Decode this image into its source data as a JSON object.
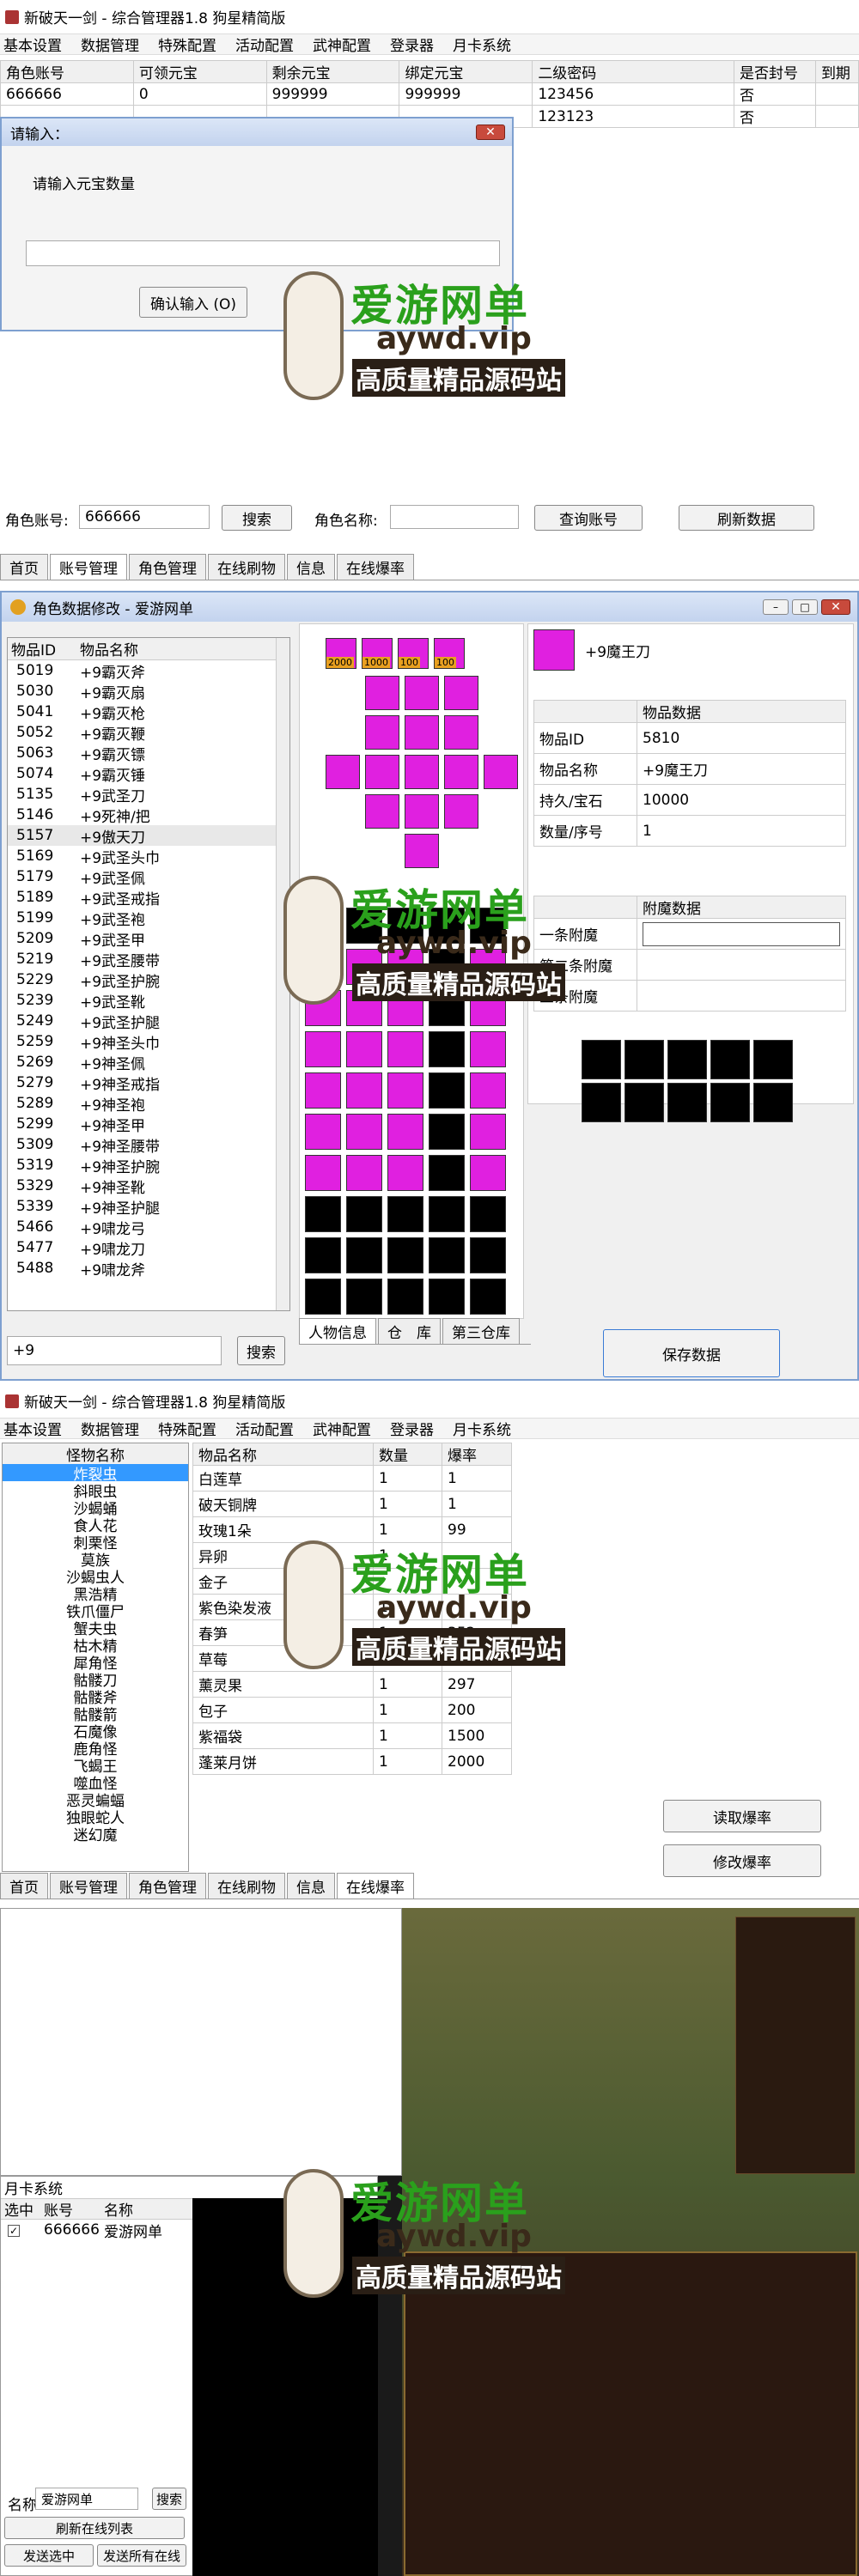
{
  "s1": {
    "title": "新破天一剑 - 综合管理器1.8 狗星精简版",
    "menu": [
      "基本设置",
      "数据管理",
      "特殊配置",
      "活动配置",
      "武神配置",
      "登录器",
      "月卡系统"
    ],
    "headers": [
      "角色账号",
      "可领元宝",
      "剩余元宝",
      "绑定元宝",
      "二级密码",
      "是否封号",
      "到期"
    ],
    "rows": [
      [
        "666666",
        "0",
        "999999",
        "999999",
        "123456",
        "否",
        ""
      ],
      [
        "",
        "",
        "",
        "",
        "123123",
        "否",
        ""
      ]
    ],
    "dialog": {
      "title": "请输入：",
      "prompt": "请输入元宝数量",
      "ok": "确认输入 (O)"
    },
    "search": {
      "acct_label": "角色账号:",
      "acct_value": "666666",
      "search_btn": "搜索",
      "name_label": "角色名称:",
      "query_btn": "查询账号",
      "refresh_btn": "刷新数据"
    },
    "tabs": [
      "首页",
      "账号管理",
      "角色管理",
      "在线刷物",
      "信息",
      "在线爆率"
    ]
  },
  "s2": {
    "title": "角色数据修改 - 爱游网单",
    "col_id": "物品ID",
    "col_name": "物品名称",
    "items": [
      [
        "5019",
        "+9霸灭斧"
      ],
      [
        "5030",
        "+9霸灭扇"
      ],
      [
        "5041",
        "+9霸灭枪"
      ],
      [
        "5052",
        "+9霸灭鞭"
      ],
      [
        "5063",
        "+9霸灭镖"
      ],
      [
        "5074",
        "+9霸灭锤"
      ],
      [
        "5135",
        "+9武圣刀"
      ],
      [
        "5146",
        "+9死神/把"
      ],
      [
        "5157",
        "+9傲天刀"
      ],
      [
        "5169",
        "+9武圣头巾"
      ],
      [
        "5179",
        "+9武圣佩"
      ],
      [
        "5189",
        "+9武圣戒指"
      ],
      [
        "5199",
        "+9武圣袍"
      ],
      [
        "5209",
        "+9武圣甲"
      ],
      [
        "5219",
        "+9武圣腰带"
      ],
      [
        "5229",
        "+9武圣护腕"
      ],
      [
        "5239",
        "+9武圣靴"
      ],
      [
        "5249",
        "+9武圣护腿"
      ],
      [
        "5259",
        "+9神圣头巾"
      ],
      [
        "5269",
        "+9神圣佩"
      ],
      [
        "5279",
        "+9神圣戒指"
      ],
      [
        "5289",
        "+9神圣袍"
      ],
      [
        "5299",
        "+9神圣甲"
      ],
      [
        "5309",
        "+9神圣腰带"
      ],
      [
        "5319",
        "+9神圣护腕"
      ],
      [
        "5329",
        "+9神圣靴"
      ],
      [
        "5339",
        "+9神圣护腿"
      ],
      [
        "5466",
        "+9啸龙弓"
      ],
      [
        "5477",
        "+9啸龙刀"
      ],
      [
        "5488",
        "+9啸龙斧"
      ]
    ],
    "badges": [
      "2000",
      "1000",
      "100",
      "100"
    ],
    "selected_item": "+9魔王刀",
    "props_header": "物品数据",
    "props": [
      [
        "物品ID",
        "5810"
      ],
      [
        "物品名称",
        "+9魔王刀"
      ],
      [
        "持久/宝石",
        "10000"
      ],
      [
        "数量/序号",
        "1"
      ]
    ],
    "attach_header": "附魔数据",
    "attach": [
      "一条附魔",
      "第二条附魔",
      "三条附魔"
    ],
    "search_value": "+9",
    "search_btn": "搜索",
    "bottom_tabs": [
      "人物信息",
      "仓　库",
      "第三仓库"
    ],
    "save_btn": "保存数据"
  },
  "s3": {
    "title": "新破天一剑 - 综合管理器1.8 狗星精简版",
    "menu": [
      "基本设置",
      "数据管理",
      "特殊配置",
      "活动配置",
      "武神配置",
      "登录器",
      "月卡系统"
    ],
    "monster_header": "怪物名称",
    "monsters": [
      "炸裂虫",
      "斜眼虫",
      "沙蝎蛹",
      "食人花",
      "刺栗怪",
      "莫族",
      "沙蝎虫人",
      "黑浩精",
      "铁爪僵尸",
      "蟹夫虫",
      "枯木精",
      "犀角怪",
      "骷髅刀",
      "骷髅斧",
      "骷髅箭",
      "石魔像",
      "鹿角怪",
      "飞蝎王",
      "噬血怪",
      "恶灵蝙蝠",
      "独眼蛇人",
      "迷幻魔"
    ],
    "drop_headers": [
      "物品名称",
      "数量",
      "爆率"
    ],
    "drops": [
      [
        "白莲草",
        "1",
        "1"
      ],
      [
        "破天铜牌",
        "1",
        "1"
      ],
      [
        "玫瑰1朵",
        "1",
        "99"
      ],
      [
        "异卵",
        "1",
        ""
      ],
      [
        "金子",
        "",
        ""
      ],
      [
        "紫色染发液",
        "1",
        ""
      ],
      [
        "春笋",
        "1",
        "352"
      ],
      [
        "草莓",
        "",
        ""
      ],
      [
        "薰灵果",
        "1",
        "297"
      ],
      [
        "包子",
        "1",
        "200"
      ],
      [
        "紫福袋",
        "1",
        "1500"
      ],
      [
        "蓬莱月饼",
        "1",
        "2000"
      ]
    ],
    "read_btn": "读取爆率",
    "modify_btn": "修改爆率",
    "tabs": [
      "首页",
      "账号管理",
      "角色管理",
      "在线刷物",
      "信息",
      "在线爆率"
    ]
  },
  "s4": {
    "panel_title": "月卡系统",
    "headers": [
      "选中",
      "账号",
      "名称"
    ],
    "row": [
      "666666",
      "爱游网单"
    ],
    "name_label": "名称",
    "name_value": "爱游网单",
    "search_btn": "搜索",
    "refresh_btn": "刷新在线列表",
    "send_sel_btn": "发送选中",
    "send_all_btn": "发送所有在线"
  },
  "watermark": {
    "brand": "爱游网单",
    "url": "aywd.vip",
    "slogan": "高质量精品源码站"
  },
  "colors": {
    "accent": "#e020e0",
    "brand_green": "#2aa01c",
    "dialog_border": "#7ea0d0",
    "selected": "#3399ff"
  }
}
